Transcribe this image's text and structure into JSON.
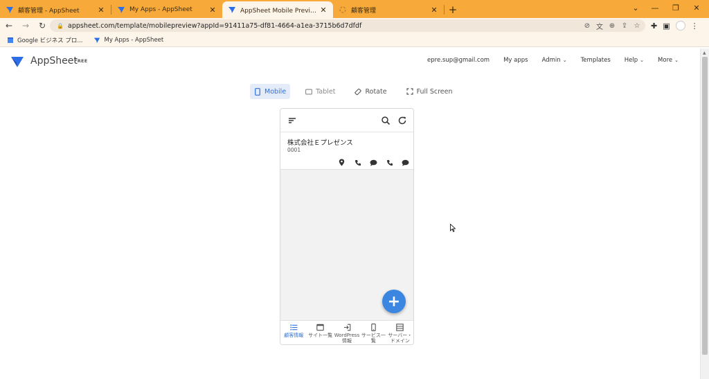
{
  "browser": {
    "tabs": [
      {
        "title": "顧客管理 - AppSheet",
        "active": false
      },
      {
        "title": "My Apps - AppSheet",
        "active": false
      },
      {
        "title": "AppSheet Mobile Preview: 顧客管理",
        "active": true
      },
      {
        "title": "顧客管理",
        "active": false
      }
    ],
    "url": "appsheet.com/template/mobilepreview?appId=91411a75-df81-4664-a1ea-3715b6d7dfdf",
    "bookmarks": [
      {
        "label": "Google ビジネス プロ..."
      },
      {
        "label": "My Apps - AppSheet"
      }
    ]
  },
  "appsheet": {
    "brand": "AppSheet",
    "plan": "FREE",
    "nav": {
      "email": "epre.sup@gmail.com",
      "my_apps": "My apps",
      "admin": "Admin",
      "templates": "Templates",
      "help": "Help",
      "more": "More"
    }
  },
  "preview": {
    "mobile": "Mobile",
    "tablet": "Tablet",
    "rotate": "Rotate",
    "fullscreen": "Full Screen"
  },
  "app": {
    "record": {
      "name": "株式会社Ｅプレゼンス",
      "code": "0001"
    },
    "bottom_nav": [
      {
        "label": "顧客情報",
        "icon": "list-icon",
        "active": true
      },
      {
        "label": "サイト一覧",
        "icon": "window-icon",
        "active": false
      },
      {
        "label": "WordPress\n情報",
        "icon": "login-icon",
        "active": false
      },
      {
        "label": "サービス一\n覧",
        "icon": "smartphone-icon",
        "active": false
      },
      {
        "label": "サーバー・\nドメイン",
        "icon": "storage-icon",
        "active": false
      }
    ]
  },
  "colors": {
    "tabbar": "#f7a93a",
    "accent": "#2f6fd6",
    "fab": "#3a86e0"
  }
}
